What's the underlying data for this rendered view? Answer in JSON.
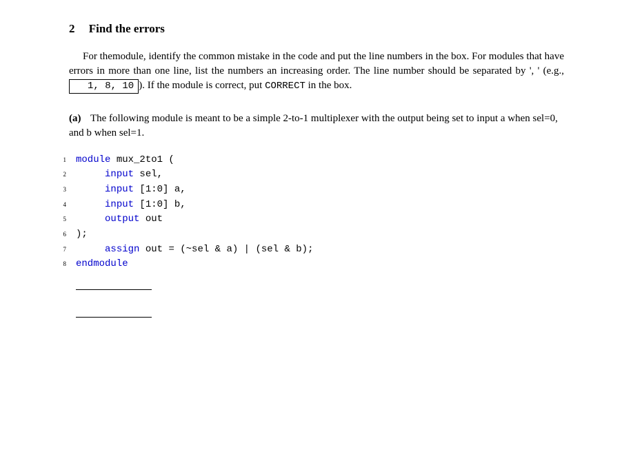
{
  "section": {
    "number": "2",
    "title": "Find the errors"
  },
  "intro": {
    "part1": "For themodule, identify the common mistake in the code and put the line numbers in the box. For modules that have errors in more than one line, list the numbers an increasing order. The line number should be separated by ', ' (e.g., ",
    "example_box": "1, 8, 10",
    "part2": "). If the module is correct, put ",
    "correct_word": "CORRECT",
    "part3": " in the box."
  },
  "item": {
    "label": "(a)",
    "text": "The following module is meant to be a simple 2-to-1 multiplexer with the output being set to input a when sel=0, and b when sel=1."
  },
  "code": {
    "lines": [
      {
        "n": "1",
        "tokens": [
          {
            "t": "module",
            "c": "kw"
          },
          {
            "t": " mux_2to1 (",
            "c": ""
          }
        ]
      },
      {
        "n": "2",
        "tokens": [
          {
            "t": "     ",
            "c": ""
          },
          {
            "t": "input",
            "c": "kw"
          },
          {
            "t": " sel,",
            "c": ""
          }
        ]
      },
      {
        "n": "3",
        "tokens": [
          {
            "t": "     ",
            "c": ""
          },
          {
            "t": "input",
            "c": "kw"
          },
          {
            "t": " [1:0] a,",
            "c": ""
          }
        ]
      },
      {
        "n": "4",
        "tokens": [
          {
            "t": "     ",
            "c": ""
          },
          {
            "t": "input",
            "c": "kw"
          },
          {
            "t": " [1:0] b,",
            "c": ""
          }
        ]
      },
      {
        "n": "5",
        "tokens": [
          {
            "t": "     ",
            "c": ""
          },
          {
            "t": "output",
            "c": "kw"
          },
          {
            "t": " out",
            "c": ""
          }
        ]
      },
      {
        "n": "6",
        "tokens": [
          {
            "t": ");",
            "c": ""
          }
        ]
      },
      {
        "n": "7",
        "tokens": [
          {
            "t": "     ",
            "c": ""
          },
          {
            "t": "assign",
            "c": "kw"
          },
          {
            "t": " out = (~sel & a) | (sel & b);",
            "c": ""
          }
        ]
      },
      {
        "n": "8",
        "tokens": [
          {
            "t": "endmodule",
            "c": "kw"
          }
        ]
      }
    ]
  }
}
